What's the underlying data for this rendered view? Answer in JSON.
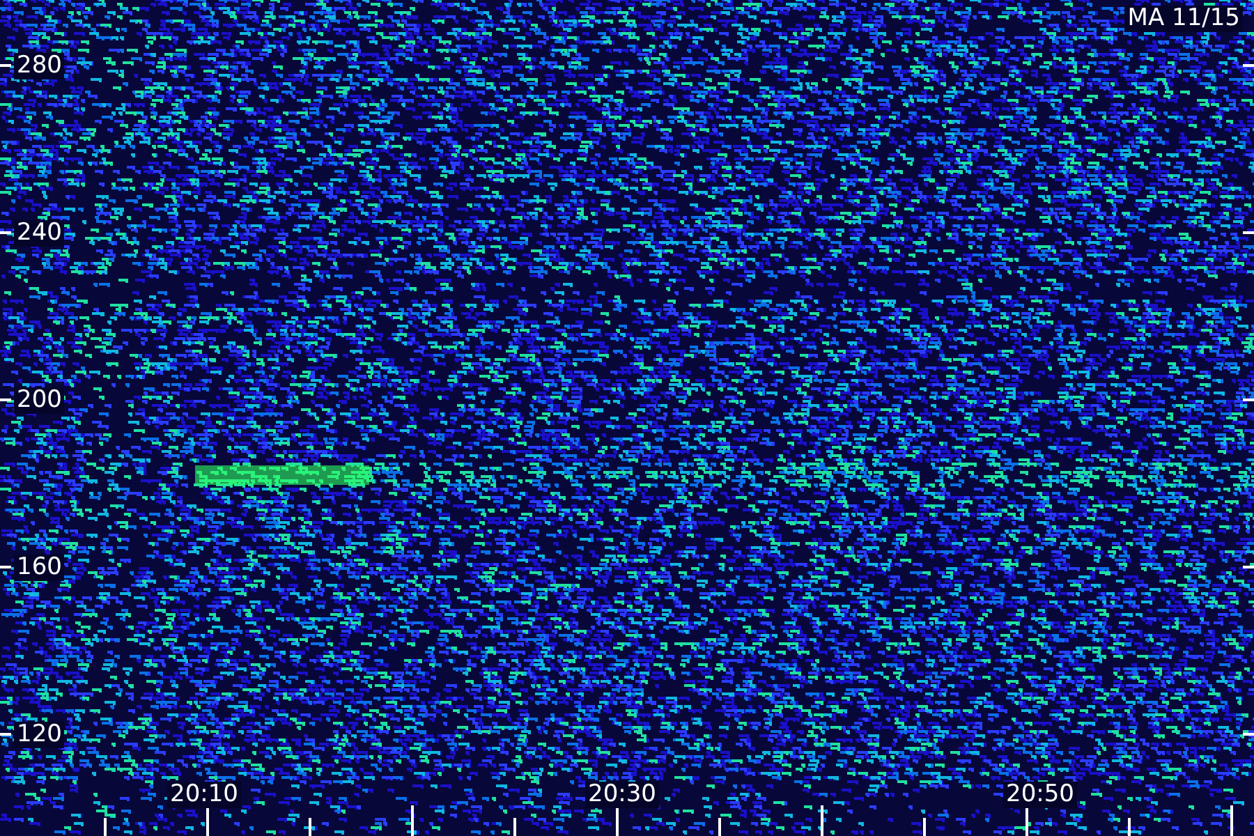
{
  "title": "MA 11/15",
  "y_axis": {
    "ticks": [
      "280",
      "240",
      "200",
      "160",
      "120"
    ]
  },
  "x_axis": {
    "ticks": [
      "20:10",
      "20:30",
      "20:50"
    ]
  }
}
